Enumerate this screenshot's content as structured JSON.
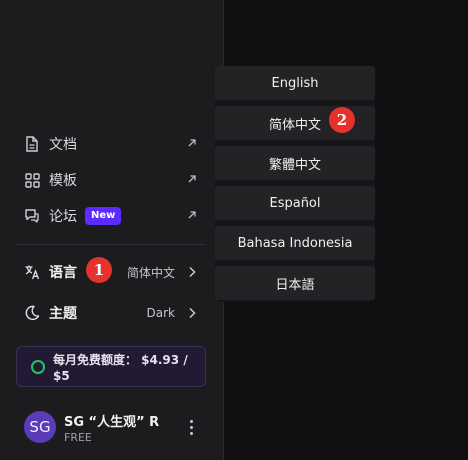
{
  "nav": {
    "items": [
      {
        "label": "文档",
        "icon": "document-icon"
      },
      {
        "label": "模板",
        "icon": "template-grid-icon"
      },
      {
        "label": "论坛",
        "icon": "forum-chat-icon",
        "badge": "New"
      }
    ]
  },
  "settings": {
    "language": {
      "label": "语言",
      "value": "简体中文",
      "icon": "translate-icon"
    },
    "theme": {
      "label": "主题",
      "value": "Dark",
      "icon": "moon-icon"
    }
  },
  "quota": {
    "text": "每月免费额度： $4.93 / $5",
    "color": "#22c55e"
  },
  "user": {
    "avatar_initials": "SG",
    "name": "SG “人生观” R",
    "plan": "FREE"
  },
  "language_menu": {
    "options": [
      "English",
      "简体中文",
      "繁體中文",
      "Español",
      "Bahasa Indonesia",
      "日本語"
    ]
  },
  "annotations": {
    "marker1": "1",
    "marker2": "2"
  },
  "colors": {
    "accent": "#5b2bff",
    "marker": "#e5322d"
  }
}
